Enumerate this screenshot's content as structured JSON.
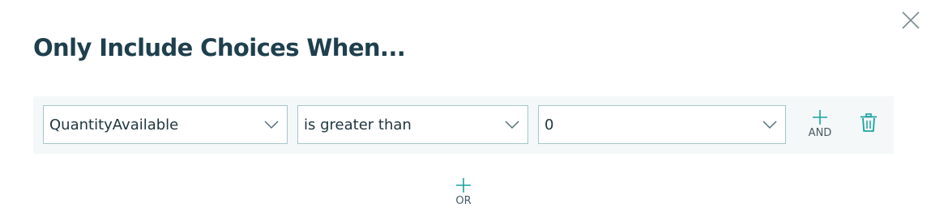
{
  "dialog": {
    "title": "Only Include Choices When...",
    "close_icon": "close-icon"
  },
  "condition": {
    "field": "QuantityAvailable",
    "operator": "is greater than",
    "value": "0",
    "dropdown_icon": "chevron-down-icon"
  },
  "actions": {
    "and_label": "AND",
    "or_label": "OR",
    "add_icon": "plus-icon",
    "delete_icon": "trash-icon"
  },
  "colors": {
    "title": "#1f3f4d",
    "accent": "#1aa3a0",
    "row_background": "#f4f8f9",
    "input_border": "#a6c6c8"
  }
}
